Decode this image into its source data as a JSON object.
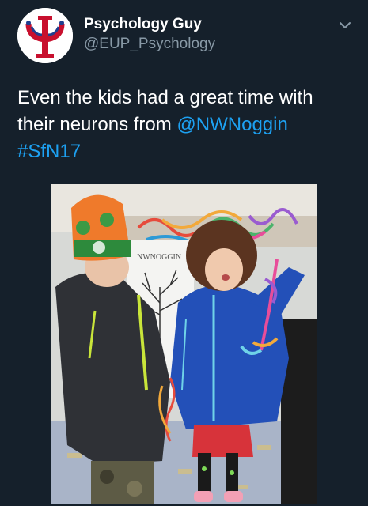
{
  "author": {
    "display_name": "Psychology Guy",
    "handle": "@EUP_Psychology",
    "avatar_icon": "psi-logo-icon"
  },
  "menu": {
    "icon": "chevron-down-icon"
  },
  "tweet": {
    "text_part1": "Even the kids had a great time with their neurons from ",
    "mention": "@NWNoggin",
    "hashtag": "#SfN17"
  },
  "photo": {
    "sign_text": "NWNOGGIN"
  },
  "colors": {
    "background": "#15202b",
    "link": "#1da1f2",
    "secondary_text": "#8899a6"
  }
}
